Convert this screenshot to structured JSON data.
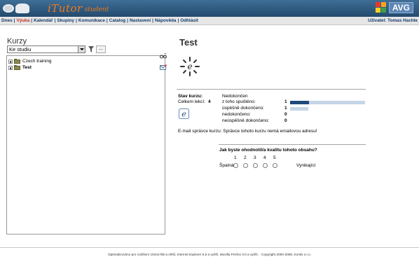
{
  "header": {
    "logo_name": "iTutor",
    "logo_sub": "student",
    "avg_label": "AVG"
  },
  "nav": {
    "items": [
      {
        "label": "Dnes",
        "active": false
      },
      {
        "label": "Výuka",
        "active": true
      },
      {
        "label": "Kalendář",
        "active": false
      },
      {
        "label": "Skupiny",
        "active": false
      },
      {
        "label": "Komunikace",
        "active": false
      },
      {
        "label": "Catalog",
        "active": false
      },
      {
        "label": "Nastavení",
        "active": false
      },
      {
        "label": "Nápověda",
        "active": false
      },
      {
        "label": "Odhlásit",
        "active": false
      }
    ],
    "separator": "|",
    "user": "Uživatel: Tomas Hachle"
  },
  "left": {
    "title": "Kurzy",
    "select_value": "Ke studiu",
    "more_label": "...",
    "tree": [
      {
        "label": "Czech training",
        "bold": false
      },
      {
        "label": "Test",
        "bold": true
      }
    ]
  },
  "course": {
    "title": "Test",
    "status_label": "Stav kurzu:",
    "lessons_label": "Celkem lekcí:",
    "lessons_count": "4",
    "status_value": "Nedokončen",
    "rows": [
      {
        "label": "z toho spuštěno:",
        "value": "1",
        "fraction": 0.25
      },
      {
        "label": "úspěšně dokončeno:",
        "value": "1",
        "fraction": 0.25
      },
      {
        "label": "nedokončeno:",
        "value": "0",
        "fraction": 0
      },
      {
        "label": "neúspěšně dokončeno:",
        "value": "0",
        "fraction": 0
      }
    ],
    "admin_email": "E-mail správce kurzu: Správce tohoto kurzu nemá emailovou adresu!"
  },
  "rating": {
    "question": "Jak byste ohodnotil/a kvalitu tohoto obsahu?",
    "numbers": [
      "1",
      "2",
      "3",
      "4",
      "5"
    ],
    "low_label": "Špatná",
    "high_label": "Vynikající"
  },
  "footer": {
    "text": "Optimalizováno pro rozlišení 1024x768 a větší, Internet Explorer 5.5 a vyšší, Mozilla Firefox 3.0 a vyšší. - Copyright 2000-2008, Kontis s.r.o."
  },
  "colors": {
    "bar_dark": "#1f4b79",
    "bar_light": "#c5d6e6",
    "header": "#2f5a80",
    "accent_orange": "#f07a1a"
  }
}
